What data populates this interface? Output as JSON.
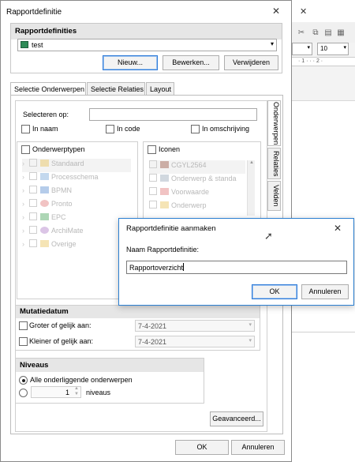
{
  "background_app": {
    "close_glyph": "✕",
    "font_size_value": "10",
    "ruler_text": "· 1 · · · 2 ·"
  },
  "dialog": {
    "title": "Rapportdefinitie",
    "close_glyph": "✕",
    "rapportdefinities": {
      "header": "Rapportdefinities",
      "selected": "test",
      "buttons": {
        "new": "Nieuw...",
        "edit": "Bewerken...",
        "delete": "Verwijderen"
      }
    },
    "tabs": [
      "Selectie Onderwerpen",
      "Selectie Relaties",
      "Layout"
    ],
    "side_tabs": [
      "Onderwerpen",
      "Relaties",
      "Velden"
    ],
    "select_on": {
      "label": "Selecteren op:",
      "value": "",
      "options": [
        "In naam",
        "In code",
        "In omschrijving"
      ]
    },
    "subject_types": {
      "header": "Onderwerptypen",
      "items": [
        "Standaard",
        "Processchema",
        "BPMN",
        "Pronto",
        "EPC",
        "ArchiMate",
        "Overige"
      ]
    },
    "icons": {
      "header": "Iconen",
      "items": [
        "CGYL2564",
        "Onderwerp & standa",
        "Voorwaarde",
        "Onderwerp"
      ]
    },
    "mutation_date": {
      "header": "Mutatiedatum",
      "rows": [
        {
          "label": "Groter of gelijk aan:",
          "value": "7-4-2021"
        },
        {
          "label": "Kleiner of gelijk aan:",
          "value": "7-4-2021"
        }
      ]
    },
    "levels": {
      "header": "Niveaus",
      "all_label": "Alle onderliggende onderwerpen",
      "count": "1",
      "levels_label": "niveaus"
    },
    "advanced_button": "Geavanceerd...",
    "ok_button": "OK",
    "cancel_button": "Annuleren"
  },
  "modal": {
    "title": "Rapportdefinitie aanmaken",
    "close_glyph": "✕",
    "field_label": "Naam Rapportdefinitie:",
    "field_value": "Rapportoverzicht",
    "ok_button": "OK",
    "cancel_button": "Annuleren"
  }
}
